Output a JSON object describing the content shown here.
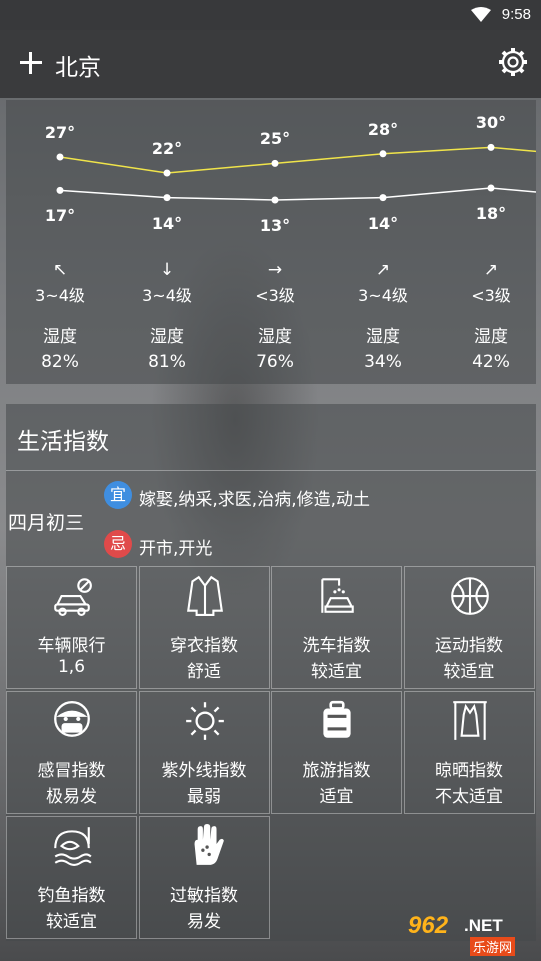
{
  "status": {
    "time": "9:58"
  },
  "header": {
    "city": "北京"
  },
  "forecast": {
    "highs": [
      "27°",
      "22°",
      "25°",
      "28°",
      "30°"
    ],
    "lows": [
      "17°",
      "14°",
      "13°",
      "14°",
      "18°"
    ],
    "high_values": [
      27,
      22,
      25,
      28,
      30
    ],
    "low_values": [
      17,
      14,
      13,
      14,
      18
    ],
    "winds": [
      {
        "arrow": "↖",
        "level": "3~4级"
      },
      {
        "arrow": "↓",
        "level": "3~4级"
      },
      {
        "arrow": "→",
        "level": "<3级"
      },
      {
        "arrow": "↗",
        "level": "3~4级"
      },
      {
        "arrow": "↗",
        "level": "<3级"
      }
    ],
    "humidity_label": "湿度",
    "humidity": [
      "82%",
      "81%",
      "76%",
      "34%",
      "42%"
    ],
    "colors": {
      "high_line": "#f0e44a",
      "low_line": "#ffffff"
    }
  },
  "life": {
    "title": "生活指数",
    "lunar_date": "四月初三",
    "yi_label": "宜",
    "yi_text": "嫁娶,纳采,求医,治病,修造,动土",
    "ji_label": "忌",
    "ji_text": "开市,开光",
    "items": [
      {
        "icon": "car-restriction-icon",
        "name": "车辆限行",
        "value": "1,6"
      },
      {
        "icon": "jacket-icon",
        "name": "穿衣指数",
        "value": "舒适"
      },
      {
        "icon": "car-wash-icon",
        "name": "洗车指数",
        "value": "较适宜"
      },
      {
        "icon": "basketball-icon",
        "name": "运动指数",
        "value": "较适宜"
      },
      {
        "icon": "mask-face-icon",
        "name": "感冒指数",
        "value": "极易发"
      },
      {
        "icon": "sun-icon",
        "name": "紫外线指数",
        "value": "最弱"
      },
      {
        "icon": "suitcase-icon",
        "name": "旅游指数",
        "value": "适宜"
      },
      {
        "icon": "clothes-hanger-icon",
        "name": "晾晒指数",
        "value": "不太适宜"
      },
      {
        "icon": "fishing-icon",
        "name": "钓鱼指数",
        "value": "较适宜"
      },
      {
        "icon": "allergy-hand-icon",
        "name": "过敏指数",
        "value": "易发"
      }
    ]
  },
  "watermark": {
    "num": "962",
    "net": ".NET",
    "cn": "乐游网"
  }
}
